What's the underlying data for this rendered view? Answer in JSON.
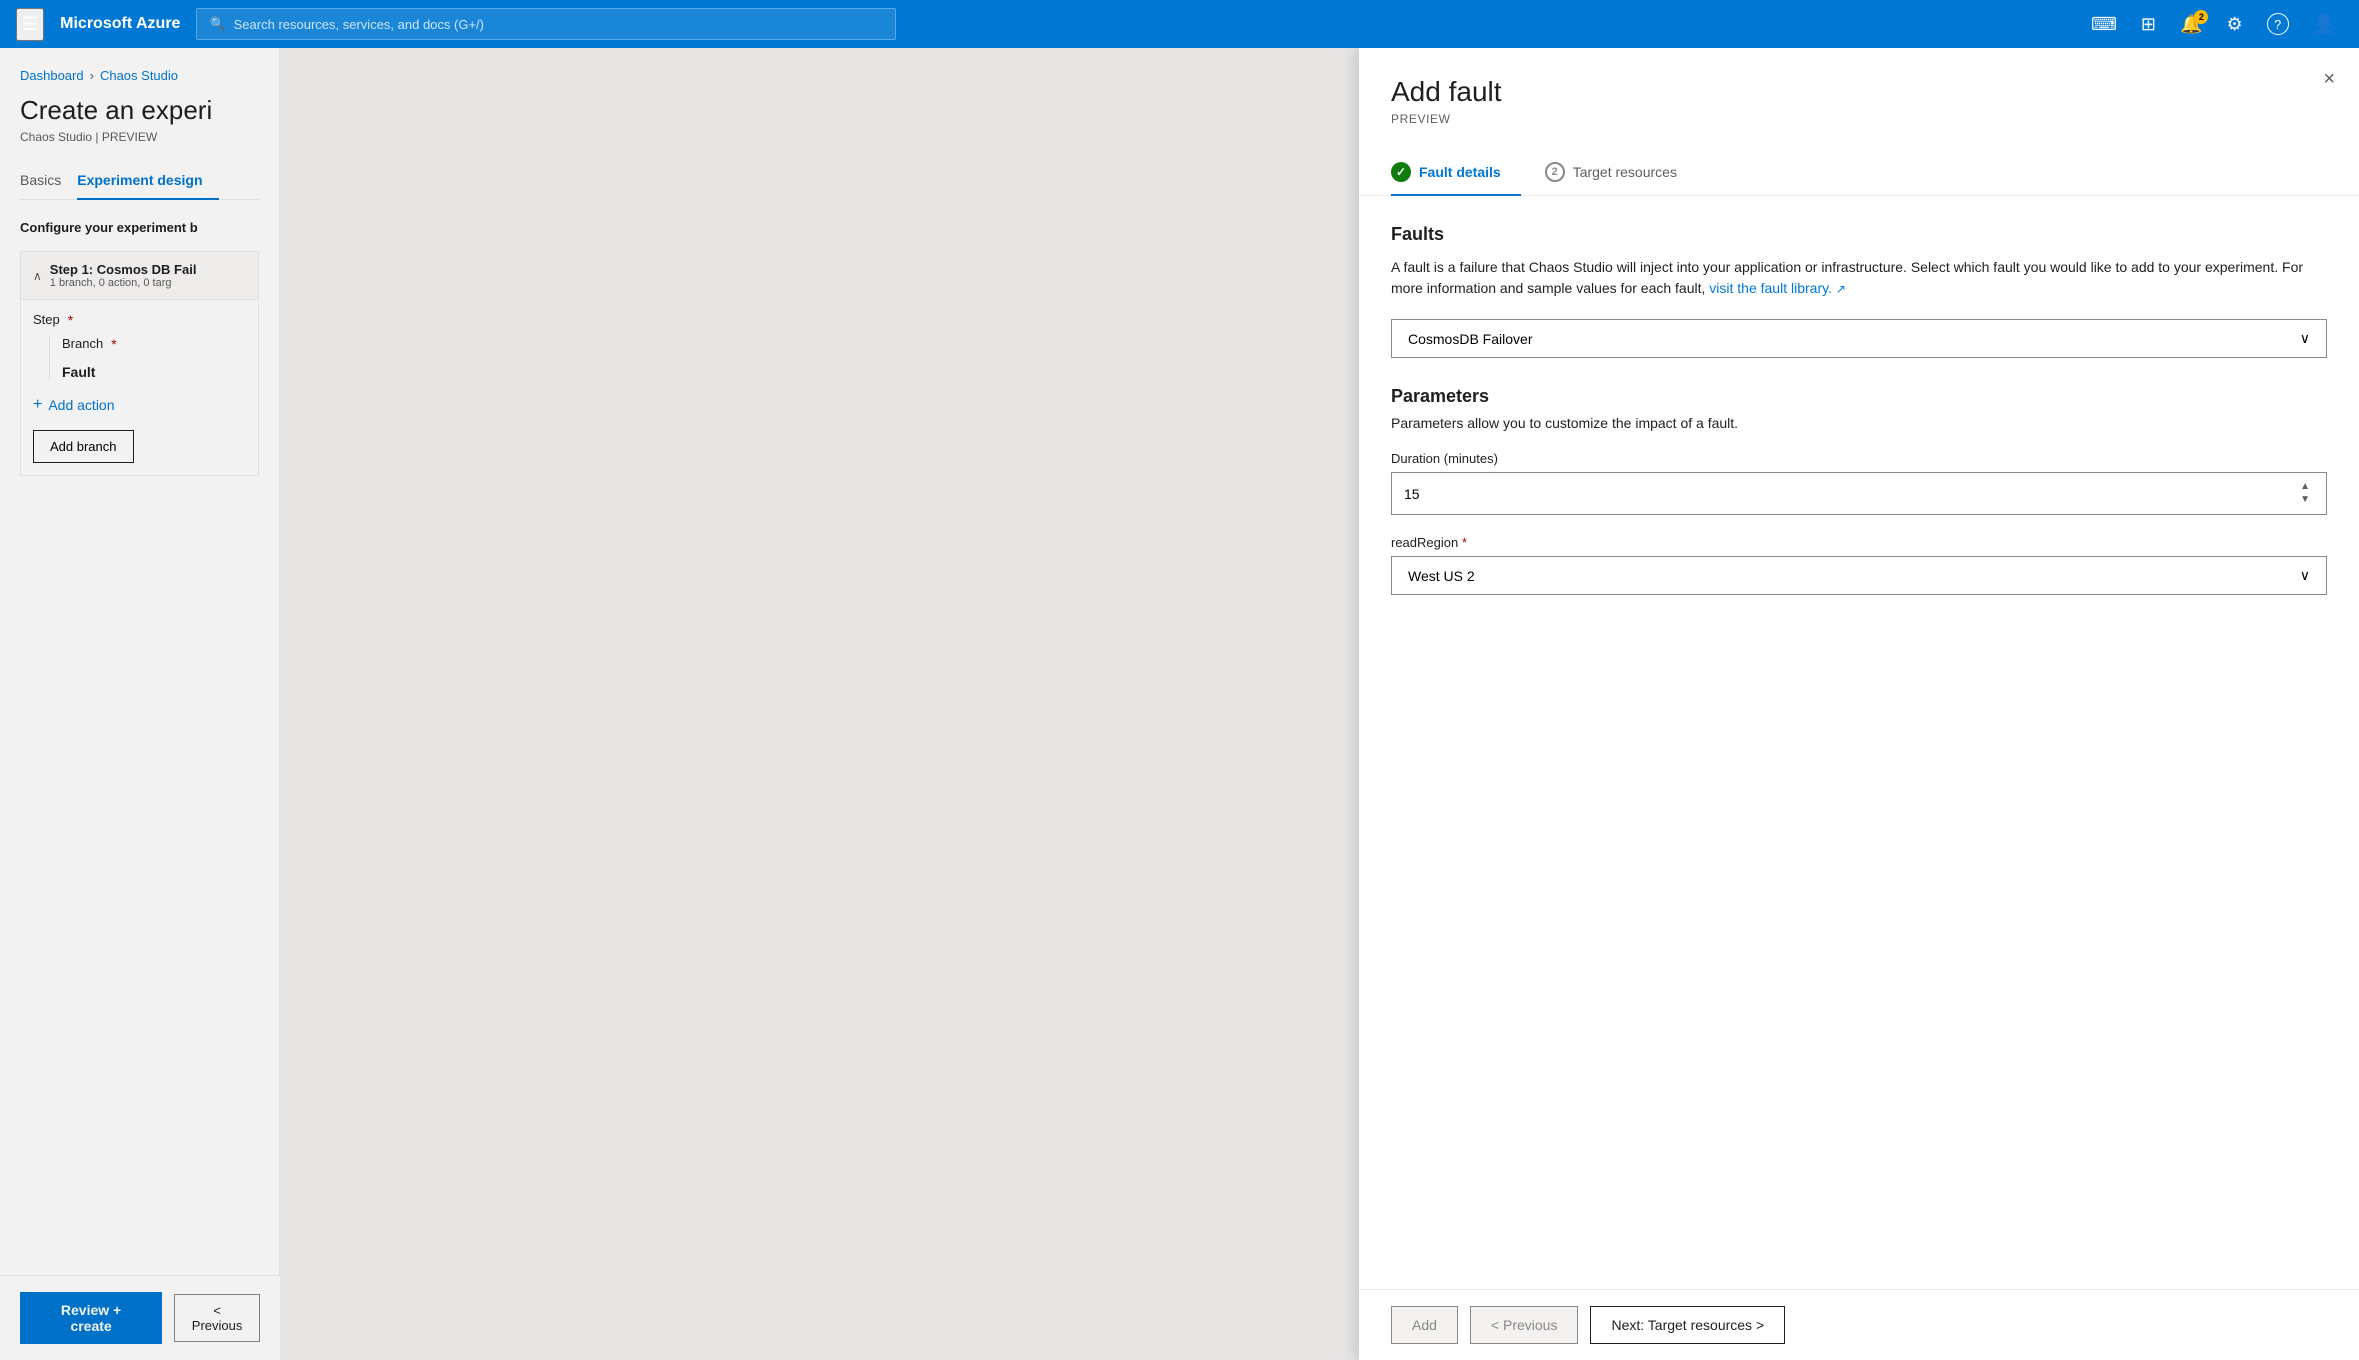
{
  "topbar": {
    "hamburger_icon": "☰",
    "title": "Microsoft Azure",
    "search_placeholder": "Search resources, services, and docs (G+/)",
    "icons": [
      {
        "name": "cloud-shell-icon",
        "symbol": "⌨",
        "badge": null
      },
      {
        "name": "portal-icon",
        "symbol": "⊞",
        "badge": null
      },
      {
        "name": "notifications-icon",
        "symbol": "🔔",
        "badge": "2"
      },
      {
        "name": "settings-icon",
        "symbol": "⚙",
        "badge": null
      },
      {
        "name": "help-icon",
        "symbol": "?",
        "badge": null
      },
      {
        "name": "account-icon",
        "symbol": "👤",
        "badge": null
      }
    ]
  },
  "breadcrumb": {
    "items": [
      "Dashboard",
      "Chaos Studio"
    ]
  },
  "page": {
    "title": "Create an experi",
    "subtitle": "Chaos Studio | PREVIEW"
  },
  "tabs": [
    {
      "label": "Basics",
      "active": false
    },
    {
      "label": "Experiment design",
      "active": true
    }
  ],
  "configure_label": "Configure your experiment b",
  "step": {
    "title": "Step 1: Cosmos DB Fail",
    "meta": "1 branch, 0 action, 0 targ",
    "step_label": "Step",
    "branch_label": "Branch",
    "fault_label": "Fault",
    "add_action_label": "Add action",
    "add_branch_label": "Add branch"
  },
  "bottom_bar": {
    "review_create_label": "Review + create",
    "previous_label": "< Previous"
  },
  "panel": {
    "title": "Add fault",
    "preview_label": "PREVIEW",
    "close_icon": "×",
    "tabs": [
      {
        "label": "Fault details",
        "state": "checked",
        "active": true
      },
      {
        "label": "Target resources",
        "number": "2",
        "active": false
      }
    ],
    "faults_section": {
      "title": "Faults",
      "description": "A fault is a failure that Chaos Studio will inject into your application or infrastructure. Select which fault you would like to add to your experiment. For more information and sample values for each fault,",
      "link_text": "visit the fault library.",
      "link_icon": "↗",
      "fault_dropdown_value": "CosmosDB Failover",
      "dropdown_icon": "∨"
    },
    "parameters_section": {
      "title": "Parameters",
      "description": "Parameters allow you to customize the impact of a fault.",
      "duration_label": "Duration (minutes)",
      "duration_value": "15",
      "read_region_label": "readRegion",
      "read_region_required": true,
      "read_region_value": "West US 2",
      "dropdown_icon": "∨"
    },
    "footer": {
      "add_label": "Add",
      "previous_label": "< Previous",
      "next_label": "Next: Target resources >"
    }
  }
}
